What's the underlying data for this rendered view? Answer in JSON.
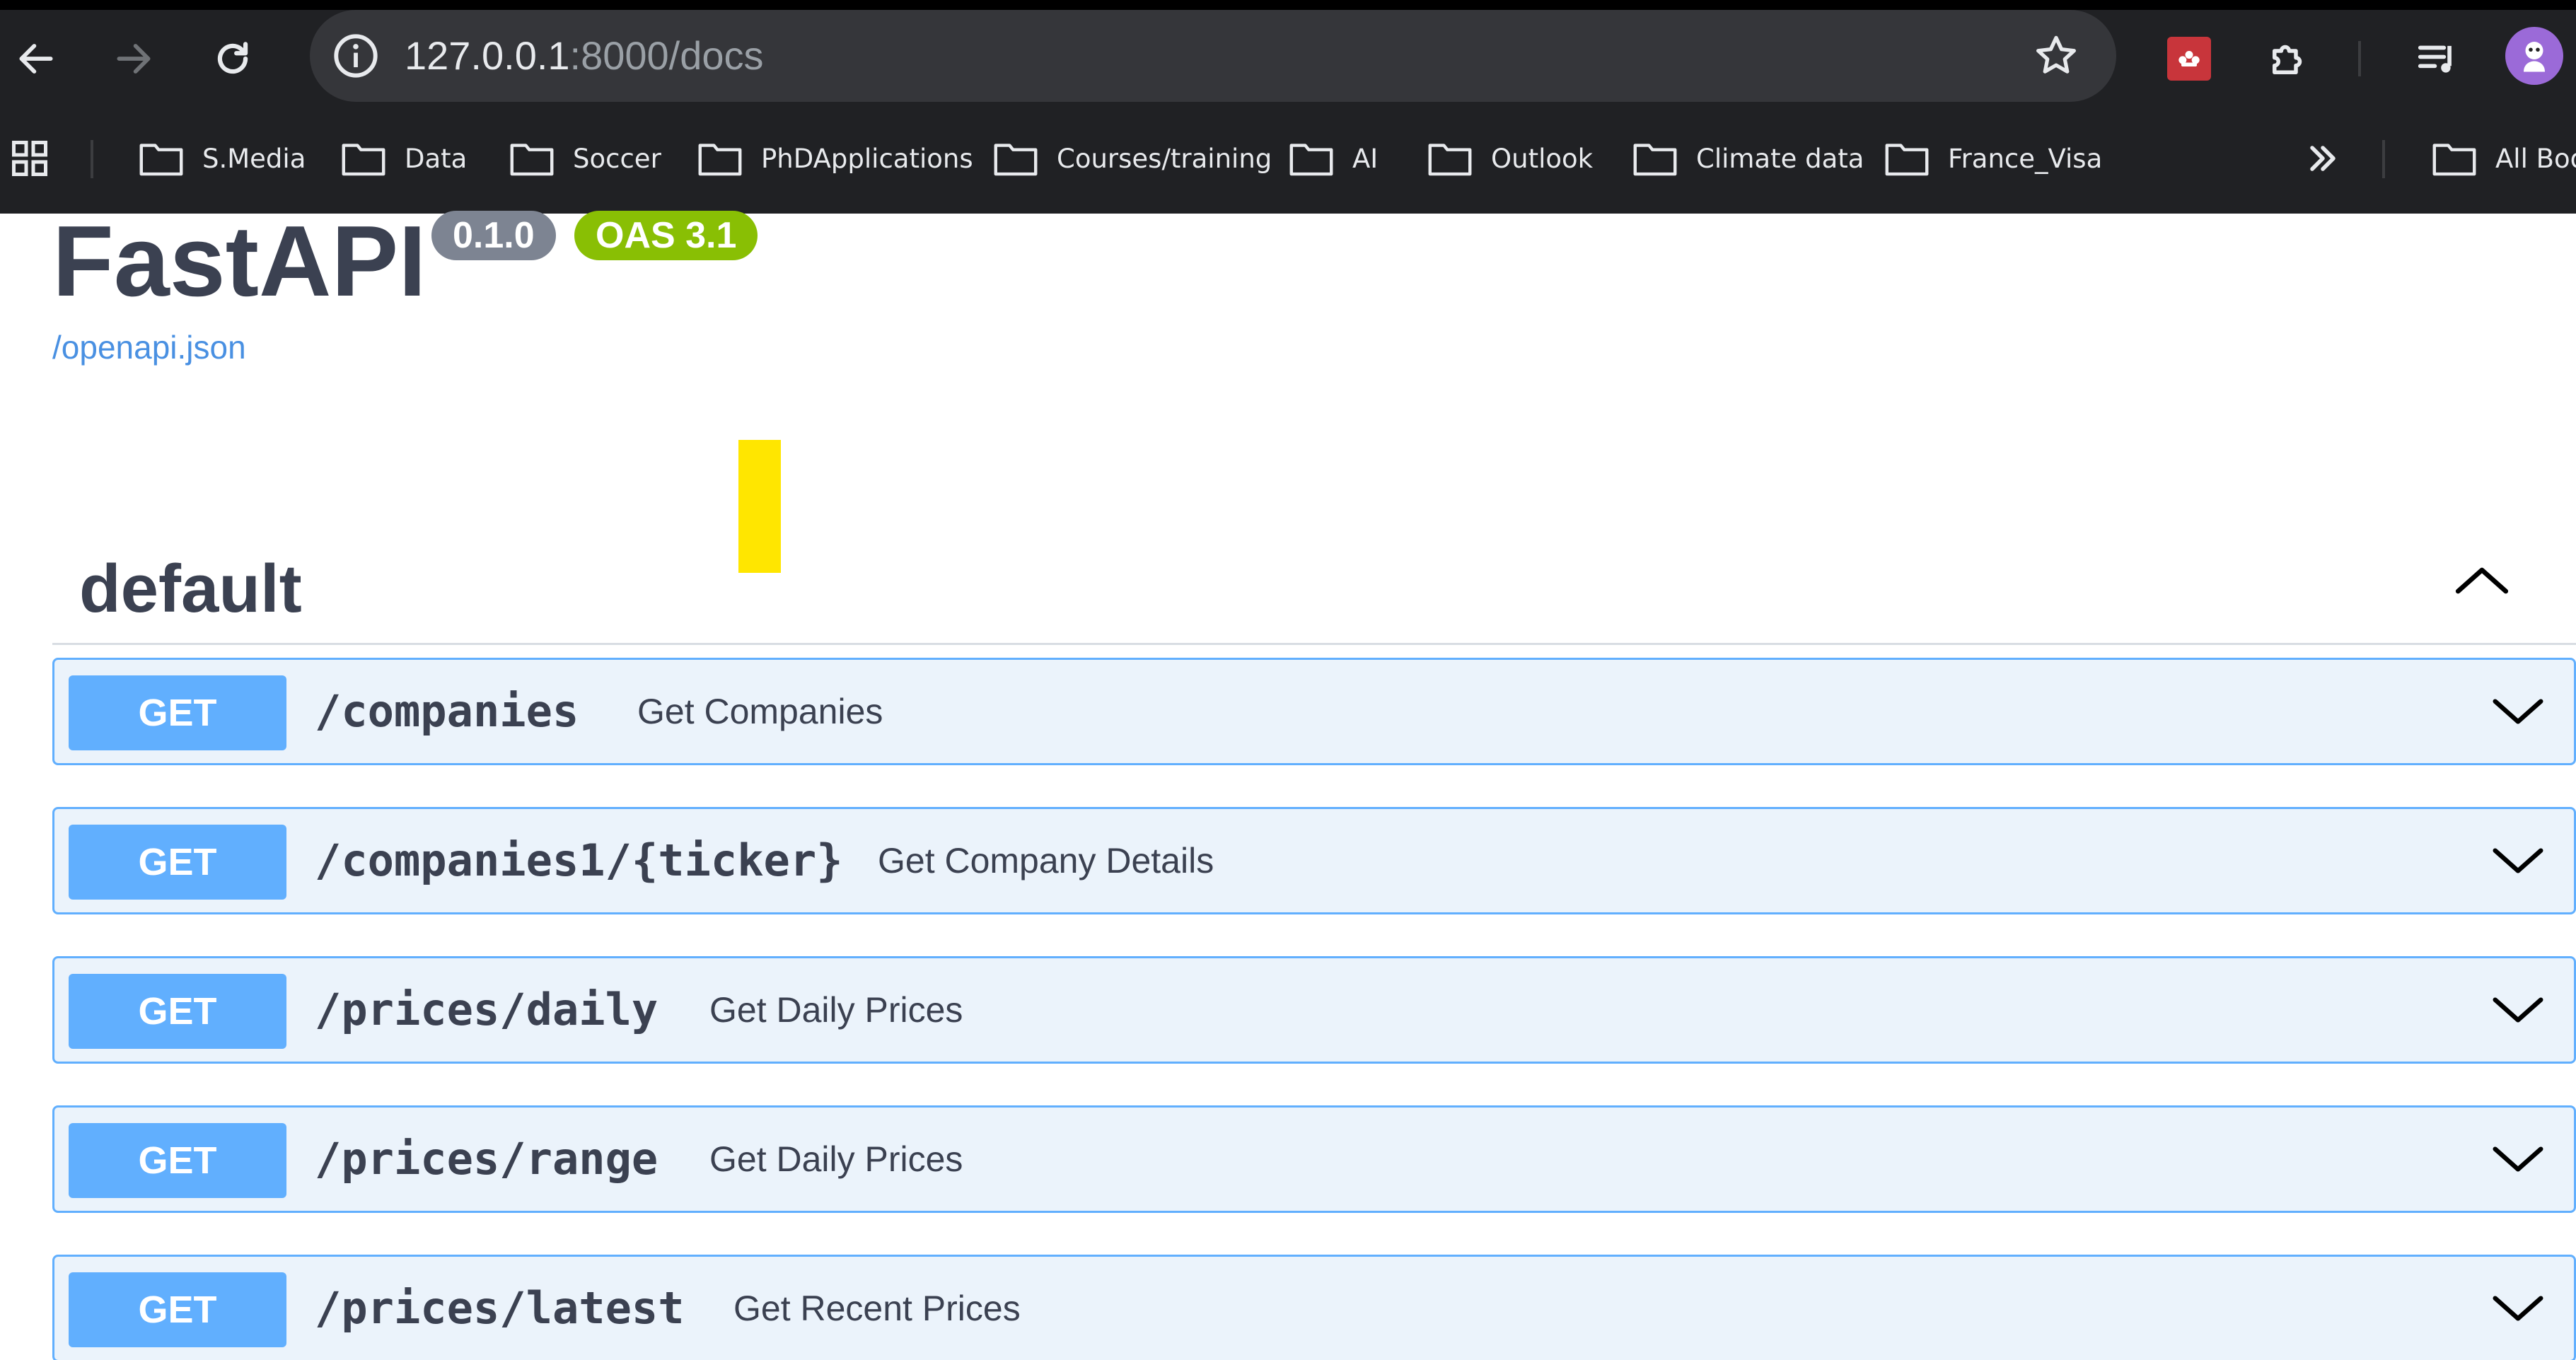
{
  "browser": {
    "url_host": "127.0.0.1",
    "url_rest": ":8000/docs",
    "icons": {
      "back": "back-arrow-icon",
      "forward": "forward-arrow-icon",
      "reload": "reload-icon",
      "site_info": "info-icon",
      "bookmark_star": "star-icon",
      "extensions": [
        "mendeley-icon",
        "puzzle-icon",
        "media-queue-icon"
      ],
      "profile": "avatar"
    },
    "bookmarks": [
      {
        "label": "S.Media"
      },
      {
        "label": "Data"
      },
      {
        "label": "Soccer"
      },
      {
        "label": "PhDApplications"
      },
      {
        "label": "Courses/training"
      },
      {
        "label": "AI"
      },
      {
        "label": "Outlook"
      },
      {
        "label": "Climate data"
      },
      {
        "label": "France_Visa"
      }
    ],
    "all_bookmarks_label": "All Boo"
  },
  "swagger": {
    "title": "FastAPI",
    "version": "0.1.0",
    "oas": "OAS 3.1",
    "spec_link": "/openapi.json",
    "section": "default",
    "method_color": "#61affe",
    "operations": [
      {
        "method": "GET",
        "path": "/companies",
        "summary": "Get Companies"
      },
      {
        "method": "GET",
        "path": "/companies1/{ticker}",
        "summary": "Get Company Details"
      },
      {
        "method": "GET",
        "path": "/prices/daily",
        "summary": "Get Daily Prices"
      },
      {
        "method": "GET",
        "path": "/prices/range",
        "summary": "Get Daily Prices"
      },
      {
        "method": "GET",
        "path": "/prices/latest",
        "summary": "Get Recent Prices"
      }
    ]
  }
}
